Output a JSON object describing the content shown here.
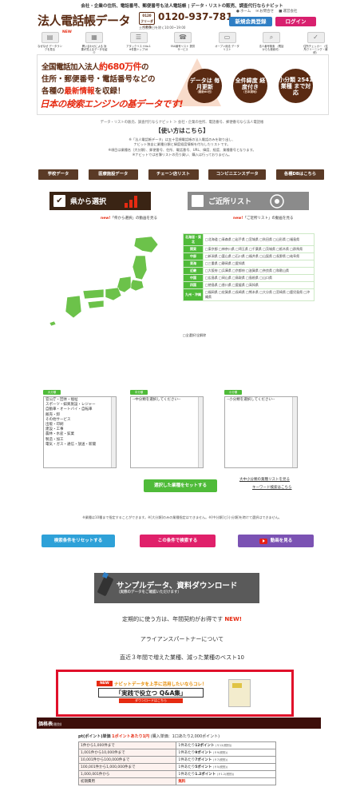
{
  "header": {
    "tagline": "会社・企業の住所、電話番号、郵便番号も法人電話帳 | データ・リストの販売、調査代行ならナビット",
    "logo": "法人電話帳データ",
    "freedial": "フリーダイヤル",
    "phone": "0120-937-781",
    "hours": "土日祝祭日を除く10:00~19:00",
    "links": [
      "ホーム",
      "お問合せ",
      "運営会社"
    ],
    "register": "新規会員登録",
    "login": "ログイン"
  },
  "steps": {
    "new_badge": "NEW",
    "items": [
      "なぜなぜ データランクを見る",
      "問い合わせによる 効果が見えるデータを紹介",
      "アタックリストNo.1 ※件数トップ10",
      "FAX番号リスト 提供サービス",
      "オープン用法 データリスト",
      "法人番号検索 （電話からも検索可）",
      "住所チェッカー （住所クリーニング・補修）"
    ]
  },
  "banner": {
    "line1a": "全国電話加入法人",
    "line1b": "約680万件",
    "line1c": "の",
    "line2": "住所・郵便番号・電話番号などの",
    "line3a": "各種の",
    "line3b": "最新情報",
    "line3c": "を収録！",
    "line4": "日本の検索エンジンの基データです!",
    "c1_main": "データは 毎月更新",
    "c1_sub": "（最新60日）",
    "c2_main": "全件緯度 経度付き",
    "c2_sub": "（日本測地）",
    "c3_main": "小分類 2541業種 まで対応",
    "c3_sub": ""
  },
  "breadcrumb": "データ・リストの販売、調査代行ならナビット ＞ 会社・企業の住所、電話番号、郵便番号なら法人電話帳",
  "howto": {
    "title": "【使い方はこちら】",
    "notes": [
      "※「法人電話帳データ」は五十音順電話帳の法人電話のみを取り出し、",
      "ナビット独自に業種分類と緯度経度情報を付与したリストです。",
      "※項目は業種名（大分類）、郵便番号、住所、電話番号、URL、緯度、経度、業種番号となります。",
      "※ナビットでは名簿リストの売り買い、購入は行っておりません。"
    ]
  },
  "db_tabs": [
    "学校データ",
    "医療施設データ",
    "チェーン店リスト",
    "コンビニエンスデータ",
    "各種DBはこちら"
  ],
  "select": {
    "pref": "県から選択",
    "near": "ご近所リスト",
    "vid1_new": "new!",
    "vid1": "「県から選択」の動画を見る",
    "vid2_new": "new!",
    "vid2": "「ご近所リスト」の動画を見る"
  },
  "regions": [
    {
      "name": "北海道・東北",
      "prefs": "□北海道 □青森県 □岩手県 □宮城県 □秋田県 □山形県 □福島県"
    },
    {
      "name": "関東",
      "prefs": "□東京都 □神奈川県 □埼玉県 □千葉県 □茨城県 □栃木県 □群馬県"
    },
    {
      "name": "中部",
      "prefs": "□新潟県 □富山県 □石川県 □福井県 □山梨県 □長野県 □岐阜県"
    },
    {
      "name": "東海",
      "prefs": "□三重県 □静岡県 □愛知県"
    },
    {
      "name": "近畿",
      "prefs": "□大阪府 □兵庫県 □京都府 □滋賀県 □奈良県 □和歌山県"
    },
    {
      "name": "中国",
      "prefs": "□広島県 □岡山県 □鳥取県 □島根県 □山口県"
    },
    {
      "name": "四国",
      "prefs": "□徳島県 □香川県 □愛媛県 □高知県"
    },
    {
      "name": "九州・沖縄",
      "prefs": "□福岡県 □佐賀県 □長崎県 □熊本県 □大分県 □宮崎県 □鹿児島県 □沖縄県"
    }
  ],
  "all_select": "□全選択/全解除",
  "boxes": {
    "large_label": "大分類",
    "large_items": [
      "官公庁・団体・福祉",
      "スポーツ・娯楽施設・レジャー",
      "自動車・オートバイ・自転車",
      "飯売・卸",
      "その他サービス",
      "出版・印刷",
      "建設・工事",
      "農林・水産・鉱業",
      "製造・加工",
      "電気・ガス・通信・放送・新聞"
    ],
    "mid_label": "中分類",
    "mid_placeholder": "--中分類を選択してください--",
    "small_label": "小分類",
    "small_placeholder": "--小分類を選択してください--",
    "set_btn": "選択した業種をセットする",
    "link1": "大中小分類の業種リストを見る",
    "link2": "キーワード検索はこちら"
  },
  "warning": "※業種は10種まで指定することができます。※[大分類]のみの業種指定はできません。※[中分類]と[小分類]を跨けて選択はできません。",
  "actions": {
    "reset": "検索条件をリセットする",
    "search": "この条件で検索する",
    "video": "動画を見る"
  },
  "sample": {
    "title": "サンプルデータ、資料ダウンロード",
    "sub": "（実際のデータをご確認いただけます）"
  },
  "info": {
    "yearly": "定期的に使う方は、年間契約がお得です",
    "yearly_new": "NEW!",
    "alliance": "アライアンスパートナーについて",
    "best": "直近３年間で増えた業種、減った業種のベスト10"
  },
  "qa": {
    "new": "NEW",
    "headline": "ナビットデータを上手に活用したいならコレ！",
    "title": "「実践で役立つ Q&A集」",
    "dl": "ダウンロードはこちら"
  },
  "price": {
    "head": "価格表",
    "head_sub": "(税別)",
    "pt_a": "pt(ポイント)単価",
    "pt_b": "1ポイントあたり1円",
    "pt_c": "(購入単価：1口あたり2,000ポイント)",
    "rows": [
      {
        "range": "1件から1,000件まで",
        "per": "1件あたり",
        "pt": "12ポイント",
        "yen": "(￥12(税別))"
      },
      {
        "range": "1,001件から10,000件まで",
        "per": "1件あたり",
        "pt": "9ポイント",
        "yen": "(￥9(税別))"
      },
      {
        "range": "10,001件から100,000件まで",
        "per": "1件あたり",
        "pt": "7ポイント",
        "yen": "(￥7(税別))"
      },
      {
        "range": "100,001件から1,000,000件まで",
        "per": "1件あたり",
        "pt": "5ポイント",
        "yen": "(￥5(税別))"
      },
      {
        "range": "1,000,001件から",
        "per": "1件あたり",
        "pt": "1.2ポイント",
        "yen": "(￥1.2(税別))"
      }
    ],
    "init_label": "初期費用",
    "init_value": "無料"
  }
}
